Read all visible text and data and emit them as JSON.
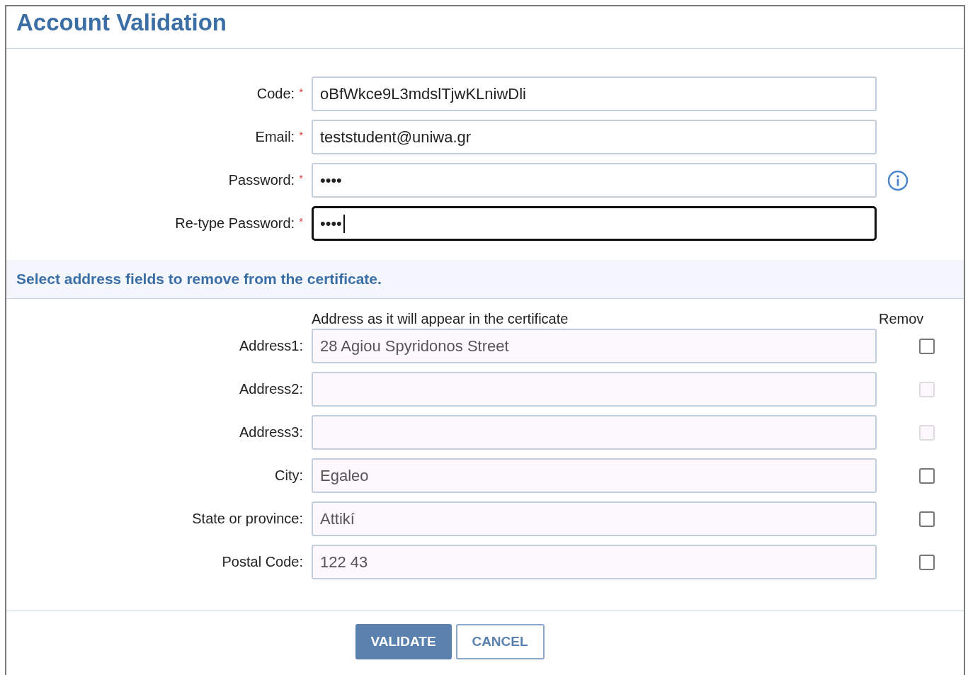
{
  "title": "Account Validation",
  "account_fields": [
    {
      "label": "Code:",
      "mark": "*",
      "value": "oBfWkce9L3mdslTjwKLniwDli",
      "focused": false,
      "info": false
    },
    {
      "label": "Email:",
      "mark": "*",
      "value": "teststudent@uniwa.gr",
      "focused": false,
      "info": false
    },
    {
      "label": "Password:",
      "mark": "*",
      "value": "••••",
      "focused": false,
      "info": true
    },
    {
      "label": "Re-type Password:",
      "mark": "*",
      "value": "••••",
      "focused": true,
      "info": false
    }
  ],
  "section_heading": "Select address fields to remove from the certificate.",
  "address_column_heading": "Address as it will appear in the certificate",
  "remove_column_heading": "Remov",
  "address_fields": [
    {
      "label": "Address1:",
      "value": "28 Agiou Spyridonos Street",
      "checked": false,
      "disabled": false
    },
    {
      "label": "Address2:",
      "checked": false,
      "disabled": true
    },
    {
      "label": "Address3:",
      "checked": false,
      "disabled": true
    },
    {
      "label": "City:",
      "value": "Egaleo",
      "checked": false,
      "disabled": false
    },
    {
      "label": "State or province:",
      "value": "Attikí",
      "checked": false,
      "disabled": false
    },
    {
      "label": "Postal Code:",
      "value": "122 43",
      "checked": false,
      "disabled": false
    }
  ],
  "buttons": [
    {
      "label": "VALIDATE",
      "kind": "primary"
    },
    {
      "label": "CANCEL",
      "kind": "secondary"
    }
  ]
}
